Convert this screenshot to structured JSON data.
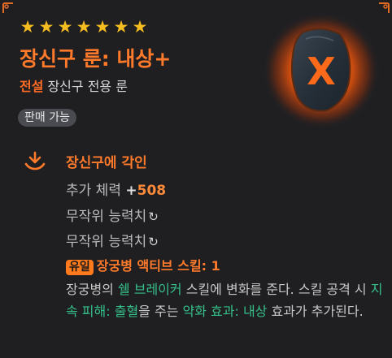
{
  "header": {
    "stars": [
      "★",
      "★",
      "★",
      "★",
      "★",
      "★",
      "★"
    ],
    "title": "장신구 룬: 내상+",
    "grade": "전설",
    "item_type": "장신구 전용 룬",
    "sale_status": "판매 가능",
    "rune_symbol": "X"
  },
  "engrave": {
    "title": "장신구에 각인",
    "bonus_stat_label": "추가 체력",
    "bonus_stat_sign": "+",
    "bonus_stat_value": "508",
    "random_stat_1": "무작위 능력치",
    "random_stat_2": "무작위 능력치",
    "refresh_glyph": "↻"
  },
  "skill": {
    "unique_tag": "유일",
    "name": "장궁병 액티브 스킬",
    "colon": ":",
    "level": "1"
  },
  "description": {
    "p1": "장궁병의 ",
    "skill_name": "쉘 브레이커",
    "p2": " 스킬에 변화를 준다. 스킬 공격 시 ",
    "effect_label": "지속 피해: 출혈",
    "p3": "을 주는 ",
    "effect2_label": "약화 효과: 내상",
    "p4": " 효과가 추가된다."
  },
  "colors": {
    "accent_orange": "#ff7a2a",
    "legend_grade": "#ff6b24",
    "star_gold": "#f6bd21",
    "highlight_green": "#35c08a",
    "background": "#1f1f22"
  }
}
